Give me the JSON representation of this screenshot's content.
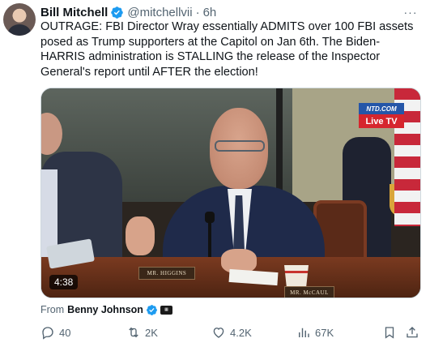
{
  "tweet": {
    "author_name": "Bill Mitchell",
    "author_handle": "@mitchellvii",
    "separator": "·",
    "time": "6h",
    "more_label": "···",
    "text": "OUTRAGE: FBI Director Wray essentially ADMITS over 100 FBI assets posed as Trump supporters at the Capitol on Jan 6th. The Biden-HARRIS administration is STALLING the release of the Inspector General's report until AFTER the election!"
  },
  "media": {
    "duration": "4:38",
    "watermark_top": "NTD.COM",
    "watermark_bottom": "Live TV",
    "nameplate_left": "MR. HIGGINS",
    "nameplate_right": "MR. McCAUL"
  },
  "attribution": {
    "label": "From",
    "name": "Benny Johnson"
  },
  "actions": {
    "replies": "40",
    "reposts": "2K",
    "likes": "4.2K",
    "views": "67K"
  },
  "colors": {
    "verified": "#1d9bf0",
    "secondary_text": "#536471",
    "primary_text": "#0f1419"
  }
}
